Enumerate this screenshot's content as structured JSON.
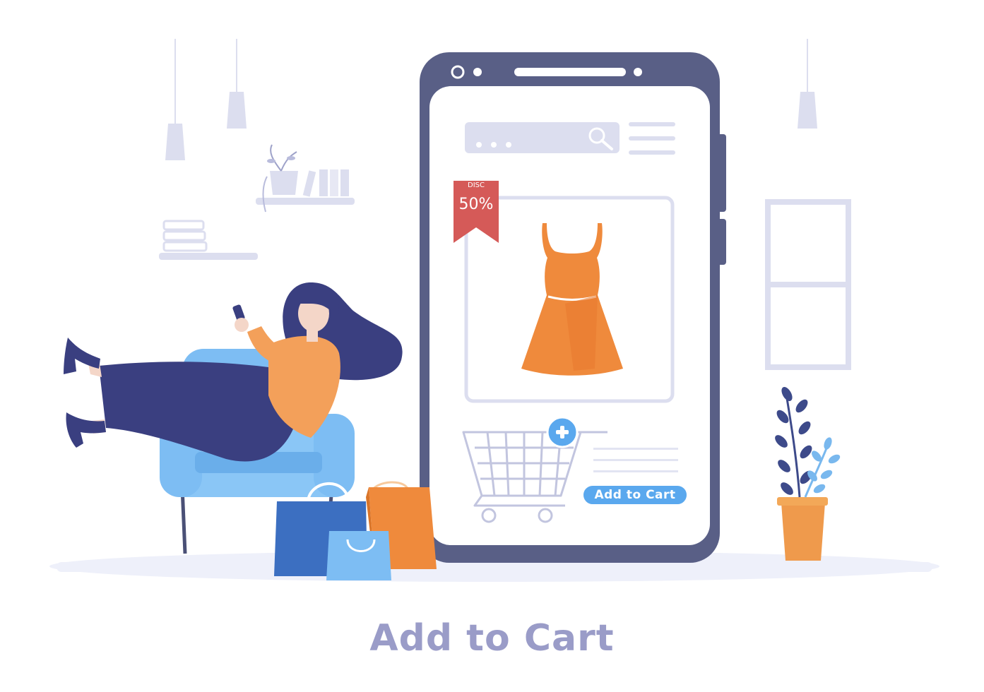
{
  "product": {
    "badge_label": "DISC",
    "badge_value": "50%",
    "add_to_cart_label": "Add to Cart"
  },
  "headline": "Add to Cart",
  "colors": {
    "phone_frame": "#595f86",
    "accent_light": "#dcdeef",
    "badge_red": "#d55a58",
    "dress_orange": "#ef8a3c",
    "button_blue": "#5aa8ee",
    "headline": "#9a9cc8",
    "chair_blue": "#7dbdf3",
    "outfit_navy": "#3a3f80"
  },
  "icons": [
    "search-icon",
    "menu-icon",
    "plus-icon",
    "cart-icon",
    "bookmark-badge"
  ]
}
